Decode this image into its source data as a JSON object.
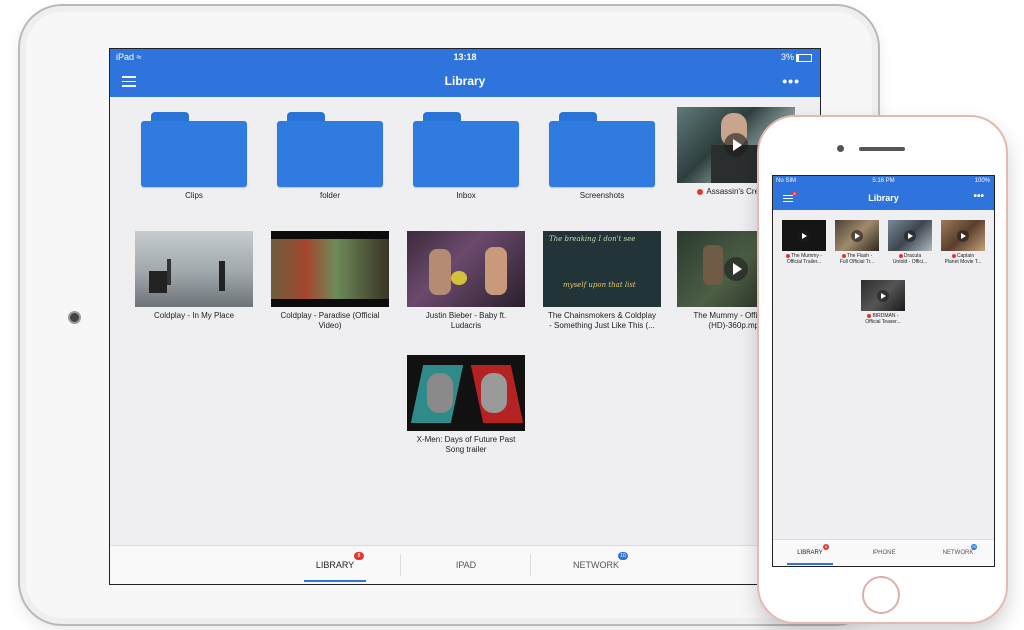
{
  "ipad": {
    "status": {
      "device": "iPad",
      "time": "13:18",
      "battery": "3%"
    },
    "title": "Library",
    "folders": [
      {
        "label": "Clips"
      },
      {
        "label": "folder"
      },
      {
        "label": "Inbox"
      },
      {
        "label": "Screenshots"
      }
    ],
    "videos": [
      {
        "label": "Assassin's Creed.p",
        "label2": "",
        "recent": true
      },
      {
        "label": "Coldplay - In My Place",
        "label2": "",
        "recent": false
      },
      {
        "label": "Coldplay - Paradise (Official",
        "label2": "Video)",
        "recent": false
      },
      {
        "label": "Justin Bieber - Baby ft.",
        "label2": "Ludacris",
        "recent": false
      },
      {
        "label": "The Chainsmokers & Coldplay",
        "label2": "- Something Just Like This (...",
        "recent": false
      },
      {
        "label": "The Mummy - Official Tr",
        "label2": "(HD)-360p.mp4",
        "recent": false
      },
      {
        "label": "X-Men: Days of Future Past",
        "label2": "Song trailer",
        "recent": false
      }
    ],
    "thumb_texts": {
      "chainsmokers_top": "The breaking I don't see",
      "chainsmokers_bottom": "myself upon that list"
    },
    "tabs": [
      {
        "label": "LIBRARY",
        "badge": "8",
        "active": true
      },
      {
        "label": "IPAD",
        "badge": "",
        "active": false
      },
      {
        "label": "NETWORK",
        "badge": "10",
        "active": false
      }
    ]
  },
  "iphone": {
    "status": {
      "carrier": "No SIM",
      "time": "5:16 PM",
      "battery": "100%"
    },
    "title": "Library",
    "menu_badge": "8",
    "videos": [
      {
        "label": "The Mummy -",
        "label2": "Official Trailer..."
      },
      {
        "label": "The Flash -",
        "label2": "Full Official Tr..."
      },
      {
        "label": "Dracula",
        "label2": "Untold - Offici..."
      },
      {
        "label": "Captain",
        "label2": "Planet Movie T..."
      },
      {
        "label": "BIRDMAN -",
        "label2": "Official Teaser..."
      }
    ],
    "tabs": [
      {
        "label": "LIBRARY",
        "badge": "8"
      },
      {
        "label": "IPHONE",
        "badge": ""
      },
      {
        "label": "NETWORK",
        "badge": "20"
      }
    ]
  },
  "colors": {
    "accent": "#2f74dc",
    "badge_red": "#e0372e",
    "folder": "#2f7be0"
  }
}
